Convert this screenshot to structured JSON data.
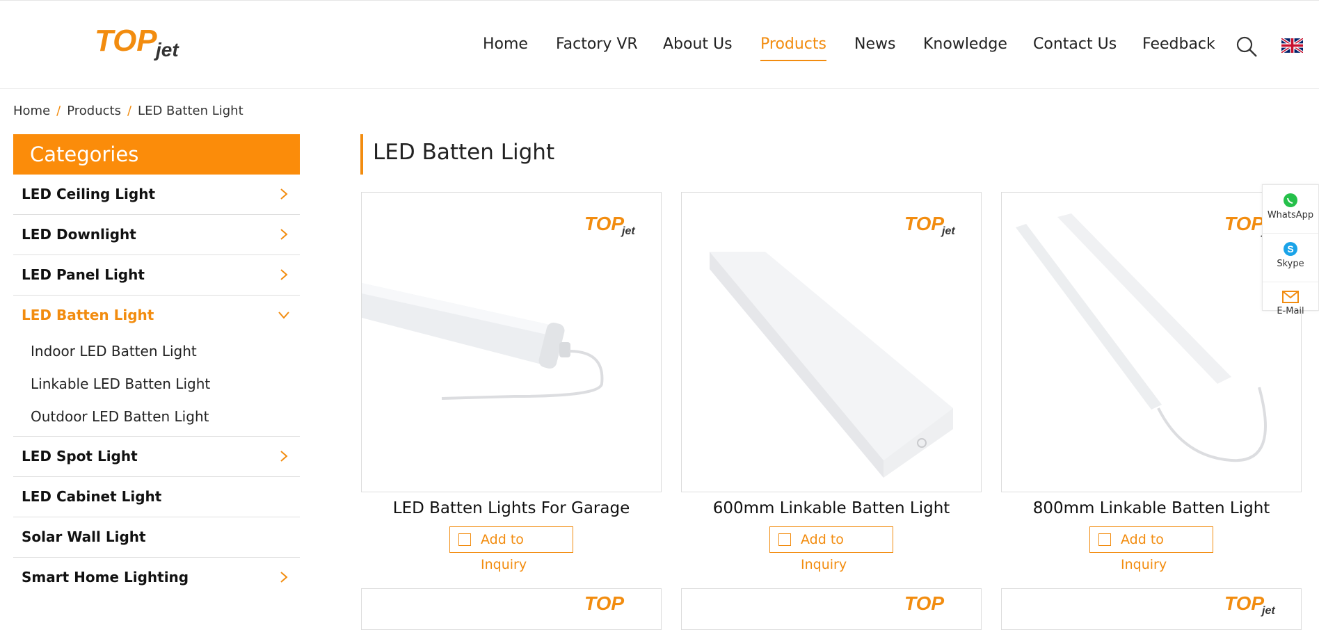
{
  "brand": {
    "logo_main": "TOP",
    "logo_sub": "jet",
    "color": "#f28c0f"
  },
  "nav": {
    "items": [
      {
        "label": "Home",
        "active": false
      },
      {
        "label": "Factory VR",
        "active": false
      },
      {
        "label": "About Us",
        "active": false
      },
      {
        "label": "Products",
        "active": true
      },
      {
        "label": "News",
        "active": false
      },
      {
        "label": "Knowledge",
        "active": false
      },
      {
        "label": "Contact Us",
        "active": false
      },
      {
        "label": "Feedback",
        "active": false
      }
    ],
    "search_icon": "search-icon",
    "language_icon": "uk-flag-icon"
  },
  "breadcrumb": {
    "items": [
      "Home",
      "Products",
      "LED Batten Light"
    ],
    "separator": "/"
  },
  "sidebar": {
    "title": "Categories",
    "items": [
      {
        "label": "LED Ceiling Light",
        "has_children": true
      },
      {
        "label": "LED Downlight",
        "has_children": true
      },
      {
        "label": "LED Panel Light",
        "has_children": true
      },
      {
        "label": "LED Batten Light",
        "has_children": true,
        "expanded": true,
        "children": [
          "Indoor LED Batten Light",
          "Linkable LED Batten Light",
          "Outdoor LED Batten Light"
        ]
      },
      {
        "label": "LED Spot Light",
        "has_children": true
      },
      {
        "label": "LED Cabinet Light",
        "has_children": false
      },
      {
        "label": "Solar Wall Light",
        "has_children": false
      },
      {
        "label": "Smart Home Lighting",
        "has_children": true
      }
    ]
  },
  "main": {
    "title": "LED Batten Light",
    "products": [
      {
        "name": "LED Batten Lights For Garage",
        "button": "Add to Inquiry"
      },
      {
        "name": "600mm Linkable Batten Light",
        "button": "Add to Inquiry"
      },
      {
        "name": "800mm Linkable Batten Light",
        "button": "Add to Inquiry"
      }
    ]
  },
  "contact_float": {
    "items": [
      {
        "label": "WhatsApp",
        "icon": "whatsapp-icon"
      },
      {
        "label": "Skype",
        "icon": "skype-icon"
      },
      {
        "label": "E-Mail",
        "icon": "email-icon"
      }
    ]
  }
}
